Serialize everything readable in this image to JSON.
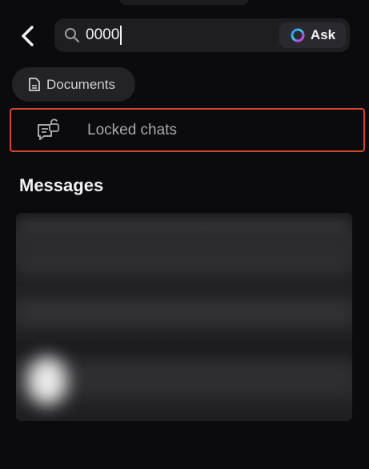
{
  "search": {
    "query": "0000",
    "ask_label": "Ask"
  },
  "filters": {
    "documents_label": "Documents"
  },
  "results": {
    "locked_chats_label": "Locked chats"
  },
  "messages": {
    "section_title": "Messages"
  },
  "colors": {
    "background": "#0b0b0d",
    "highlight_border": "#d4452f",
    "search_bg": "#1e1e21",
    "chip_bg": "#232326"
  },
  "icons": {
    "back": "chevron-left-icon",
    "search": "magnifier-icon",
    "ask": "ai-ring-icon",
    "documents": "document-icon",
    "locked_chats": "locked-chat-icon"
  }
}
